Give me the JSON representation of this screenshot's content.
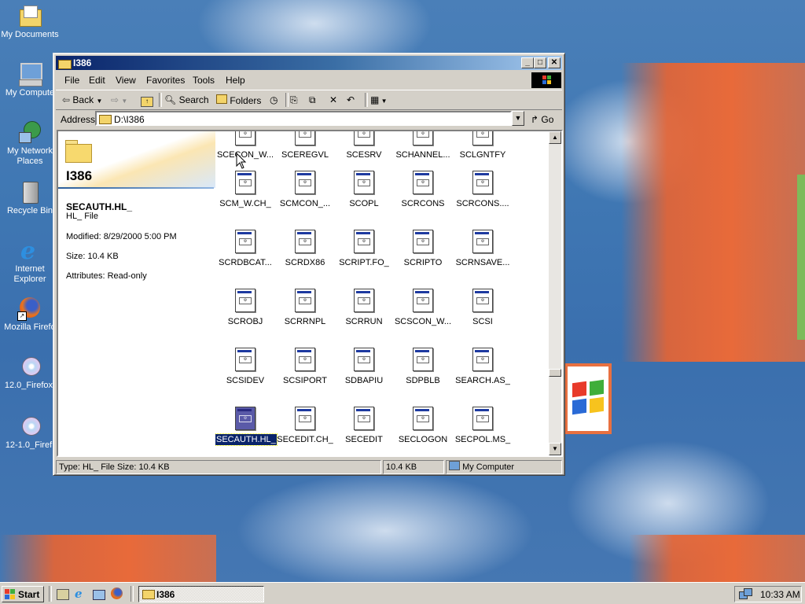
{
  "desktop": {
    "icons": [
      {
        "label": "My Documents",
        "icon": "my-documents-icon"
      },
      {
        "label": "My Compute",
        "icon": "my-computer-icon"
      },
      {
        "label": "My Network",
        "label2": "Places",
        "icon": "network-places-icon"
      },
      {
        "label": "Recycle Bin",
        "icon": "recycle-bin-icon"
      },
      {
        "label": "Internet",
        "label2": "Explorer",
        "icon": "internet-explorer-icon"
      },
      {
        "label": "Mozilla Firefo",
        "icon": "firefox-icon"
      },
      {
        "label": "12.0_Firefox.",
        "icon": "cd-installer-icon"
      },
      {
        "label": "12-1.0_Firef.",
        "icon": "cd-installer-icon"
      }
    ]
  },
  "window": {
    "title": "I386",
    "menu": [
      "File",
      "Edit",
      "View",
      "Favorites",
      "Tools",
      "Help"
    ],
    "toolbar": {
      "back_label": "Back",
      "search_label": "Search",
      "folders_label": "Folders"
    },
    "address": {
      "label": "Address",
      "value": "D:\\I386",
      "go_label": "Go"
    },
    "info_pane": {
      "folder_name": "I386",
      "file_name": "SECAUTH.HL_",
      "file_type": "HL_ File",
      "modified": "Modified: 8/29/2000 5:00 PM",
      "size": "Size: 10.4 KB",
      "attributes": "Attributes: Read-only"
    },
    "files": [
      [
        "SCECON_W...",
        "SCEREGVL",
        "SCESRV",
        "SCHANNEL...",
        "SCLGNTFY"
      ],
      [
        "SCM_W.CH_",
        "SCMCON_...",
        "SCOPL",
        "SCRCONS",
        "SCRCONS...."
      ],
      [
        "SCRDBCAT...",
        "SCRDX86",
        "SCRIPT.FO_",
        "SCRIPTO",
        "SCRNSAVE..."
      ],
      [
        "SCROBJ",
        "SCRRNPL",
        "SCRRUN",
        "SCSCON_W...",
        "SCSI"
      ],
      [
        "SCSIDEV",
        "SCSIPORT",
        "SDBAPIU",
        "SDPBLB",
        "SEARCH.AS_"
      ],
      [
        "SECAUTH.HL_",
        "SECEDIT.CH_",
        "SECEDIT",
        "SECLOGON",
        "SECPOL.MS_"
      ]
    ],
    "selected_file": "SECAUTH.HL_",
    "status": {
      "text": "Type: HL_ File Size: 10.4 KB",
      "size": "10.4 KB",
      "zone": "My Computer"
    }
  },
  "taskbar": {
    "start_label": "Start",
    "task_label": "I386",
    "clock": "10:33 AM"
  },
  "colors": {
    "titlebar_start": "#0a246a",
    "titlebar_end": "#a6caf0",
    "face": "#d4d0c8",
    "desktop": "#3a6ea5",
    "selection": "#0a246a"
  }
}
